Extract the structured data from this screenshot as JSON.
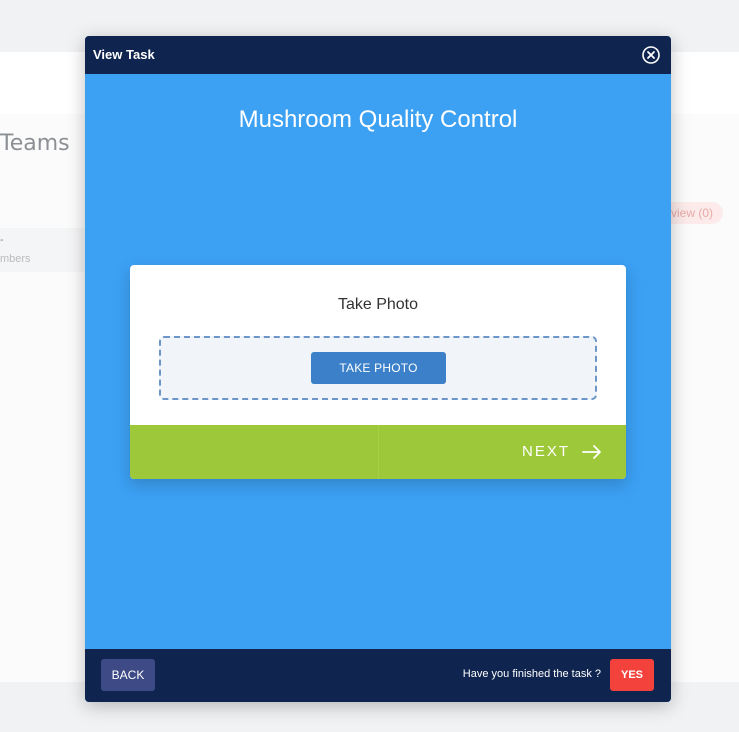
{
  "background": {
    "section_title": "Teams",
    "row_marker": "-",
    "row_subtitle": "mbers",
    "review_badge": "view (0)"
  },
  "modal": {
    "title": "View Task",
    "close_icon": "close-circle-icon",
    "task_title": "Mushroom Quality Control",
    "step": {
      "label": "Take Photo",
      "take_photo_button": "TAKE PHOTO",
      "next_label": "NEXT",
      "next_icon": "arrow-right-icon"
    },
    "footer": {
      "back_label": "BACK",
      "finished_question": "Have you finished the task ?",
      "yes_label": "YES"
    }
  },
  "colors": {
    "modal_body": "#3ca0f3",
    "modal_chrome": "#0f244f",
    "next_bar": "#9dc83a",
    "take_photo_button": "#3b80c8",
    "back_button": "#3e4a86",
    "yes_button": "#f3413c"
  }
}
